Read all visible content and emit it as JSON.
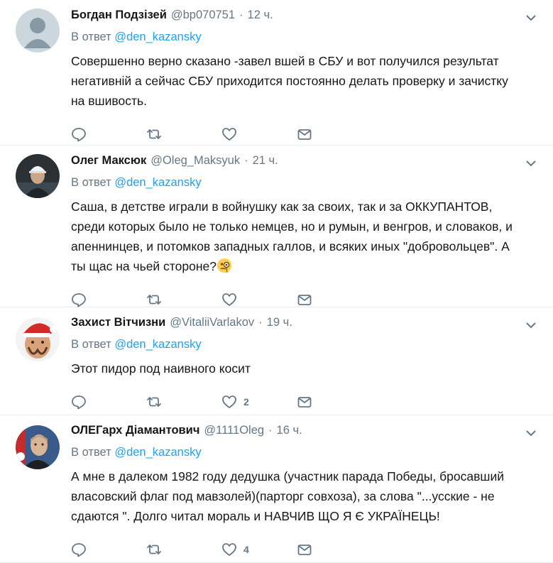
{
  "colors": {
    "link": "#1da1f2",
    "muted": "#657786",
    "text": "#14171a",
    "divider": "#e6ecf0"
  },
  "icons": {
    "reply": "reply-icon",
    "retweet": "retweet-icon",
    "like": "heart-icon",
    "dm": "envelope-icon",
    "menu": "chevron-down-icon"
  },
  "tweets": [
    {
      "name": "Богдан Подзізей",
      "handle": "@bp070751",
      "sep": "·",
      "time": "12 ч.",
      "reply_prefix": "В ответ",
      "reply_to": "@den_kazansky",
      "text": "Совершенно верно сказано -завел вшей в СБУ и вот получился результат\nнегативній а сейчас СБУ приходится постоянно делать проверку и зачистку\nна вшивость.",
      "likes": ""
    },
    {
      "name": "Олег Максюк",
      "handle": "@Oleg_Maksyuk",
      "sep": "·",
      "time": "21 ч.",
      "reply_prefix": "В ответ",
      "reply_to": "@den_kazansky",
      "text": "Саша, в детстве играли в войнушку как за своих, так и за ОККУПАНТОВ,\nсреди которых было не только немцев, но и румын, и венгров, и словаков, и\nапеннинцев, и потомков западных галлов, и всяких иных \"добровольцев\". А\nты щас на чьей стороне?",
      "likes": ""
    },
    {
      "name": "Захист Вітчизни",
      "handle": "@VitaliiVarlakov",
      "sep": "·",
      "time": "19 ч.",
      "reply_prefix": "В ответ",
      "reply_to": "@den_kazansky",
      "text": "Этот пидор под наивного косит",
      "likes": "2"
    },
    {
      "name": "ОЛЕГарх Діамантович",
      "handle": "@1111Oleg",
      "sep": "·",
      "time": "16 ч.",
      "reply_prefix": "В ответ",
      "reply_to": "@den_kazansky",
      "text": "А мне в далеком 1982 году дедушка (участник парада Победы, бросавший\nвласовский флаг под мавзолей)(парторг совхоза), за слова \"...усские - не\nсдаются \". Долго читал мораль и НАВЧИВ ЩО Я Є УКРАЇНЕЦЬ!",
      "likes": "4"
    }
  ]
}
